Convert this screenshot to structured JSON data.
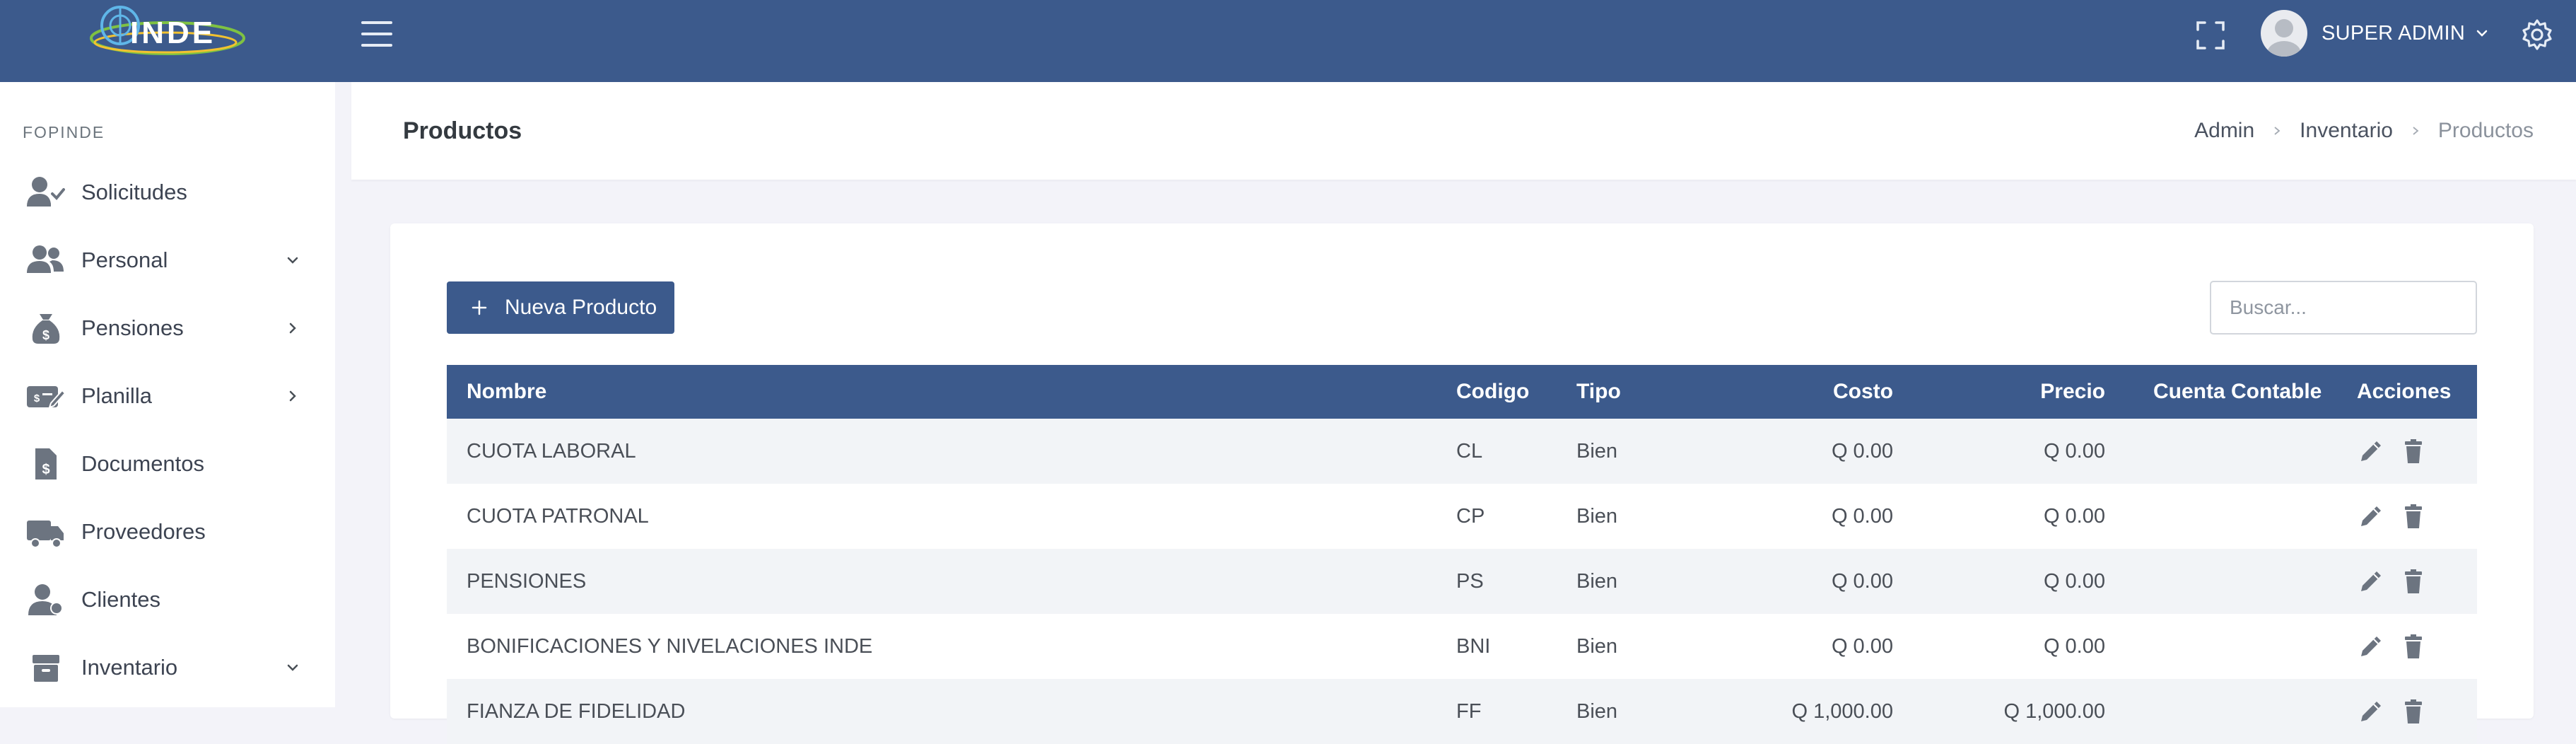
{
  "header": {
    "logo_text": "INDE",
    "user_name": "SUPER ADMIN"
  },
  "sidebar": {
    "section_title": "FOPINDE",
    "items": [
      {
        "label": "Solicitudes",
        "icon": "user-check-icon",
        "chevron": ""
      },
      {
        "label": "Personal",
        "icon": "users-icon",
        "chevron": "down"
      },
      {
        "label": "Pensiones",
        "icon": "money-bag-icon",
        "chevron": "right"
      },
      {
        "label": "Planilla",
        "icon": "money-check-edit-icon",
        "chevron": "right"
      },
      {
        "label": "Documentos",
        "icon": "file-invoice-dollar-icon",
        "chevron": ""
      },
      {
        "label": "Proveedores",
        "icon": "truck-icon",
        "chevron": ""
      },
      {
        "label": "Clientes",
        "icon": "user-tie-icon",
        "chevron": ""
      },
      {
        "label": "Inventario",
        "icon": "box-icon",
        "chevron": "down"
      }
    ]
  },
  "page": {
    "title": "Productos",
    "breadcrumb": [
      "Admin",
      "Inventario",
      "Productos"
    ]
  },
  "toolbar": {
    "new_button_label": "Nueva Producto",
    "search_placeholder": "Buscar..."
  },
  "table": {
    "columns": [
      "Nombre",
      "Codigo",
      "Tipo",
      "Costo",
      "Precio",
      "Cuenta Contable",
      "Acciones"
    ],
    "rows": [
      {
        "nombre": "CUOTA LABORAL",
        "codigo": "CL",
        "tipo": "Bien",
        "costo": "Q 0.00",
        "precio": "Q 0.00",
        "cuenta": ""
      },
      {
        "nombre": "CUOTA PATRONAL",
        "codigo": "CP",
        "tipo": "Bien",
        "costo": "Q 0.00",
        "precio": "Q 0.00",
        "cuenta": ""
      },
      {
        "nombre": "PENSIONES",
        "codigo": "PS",
        "tipo": "Bien",
        "costo": "Q 0.00",
        "precio": "Q 0.00",
        "cuenta": ""
      },
      {
        "nombre": "BONIFICACIONES Y NIVELACIONES INDE",
        "codigo": "BNI",
        "tipo": "Bien",
        "costo": "Q 0.00",
        "precio": "Q 0.00",
        "cuenta": ""
      },
      {
        "nombre": "FIANZA DE FIDELIDAD",
        "codigo": "FF",
        "tipo": "Bien",
        "costo": "Q 1,000.00",
        "precio": "Q 1,000.00",
        "cuenta": ""
      }
    ]
  },
  "colors": {
    "primary": "#3c5a8c",
    "page_bg": "#f3f3f9",
    "row_stripe": "#f2f4f7",
    "icon_gray": "#6c7480"
  }
}
